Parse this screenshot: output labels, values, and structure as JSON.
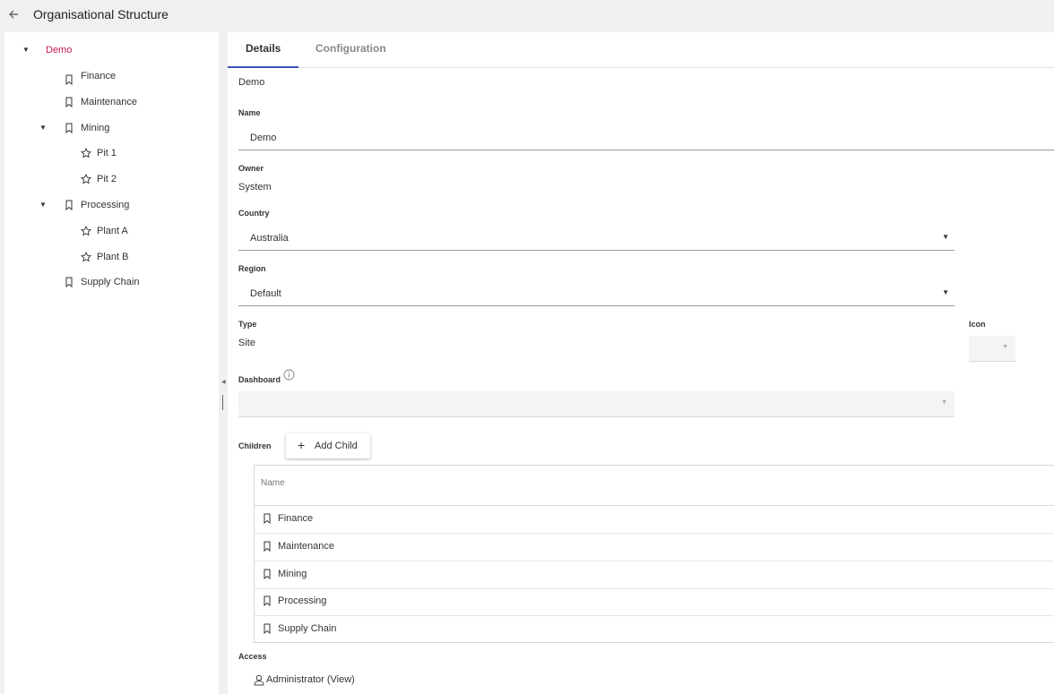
{
  "header": {
    "title": "Organisational Structure",
    "back_icon": "arrow-left-icon"
  },
  "tree": {
    "root": {
      "label": "Demo",
      "color": "#c2185b"
    },
    "items": [
      {
        "label": "Finance",
        "icon": "bookmark-icon"
      },
      {
        "label": "Maintenance",
        "icon": "bookmark-icon"
      },
      {
        "label": "Mining",
        "icon": "bookmark-icon"
      },
      {
        "label": "Pit 1",
        "icon": "star-icon"
      },
      {
        "label": "Pit 2",
        "icon": "star-icon"
      },
      {
        "label": "Processing",
        "icon": "bookmark-icon"
      },
      {
        "label": "Plant A",
        "icon": "star-icon"
      },
      {
        "label": "Plant B",
        "icon": "star-icon"
      },
      {
        "label": "Supply Chain",
        "icon": "bookmark-icon"
      }
    ]
  },
  "tabs": [
    {
      "label": "Details"
    },
    {
      "label": "Configuration"
    }
  ],
  "details": {
    "heading": "Demo",
    "name_label": "Name",
    "name_value": "Demo",
    "owner_label": "Owner",
    "owner_value": "System",
    "country_label": "Country",
    "country_value": "Australia",
    "region_label": "Region",
    "region_value": "Default",
    "type_label": "Type",
    "type_value": "Site",
    "icon_label": "Icon",
    "dashboard_label": "Dashboard",
    "children_label": "Children",
    "add_child_label": "Add Child",
    "table_header": "Name",
    "children": [
      {
        "label": "Finance"
      },
      {
        "label": "Maintenance"
      },
      {
        "label": "Mining"
      },
      {
        "label": "Processing"
      },
      {
        "label": "Supply Chain"
      }
    ],
    "access_label": "Access",
    "access_value": "Administrator (View)"
  },
  "colors": {
    "accent": "#3f51b5",
    "selected": "#c2185b"
  }
}
